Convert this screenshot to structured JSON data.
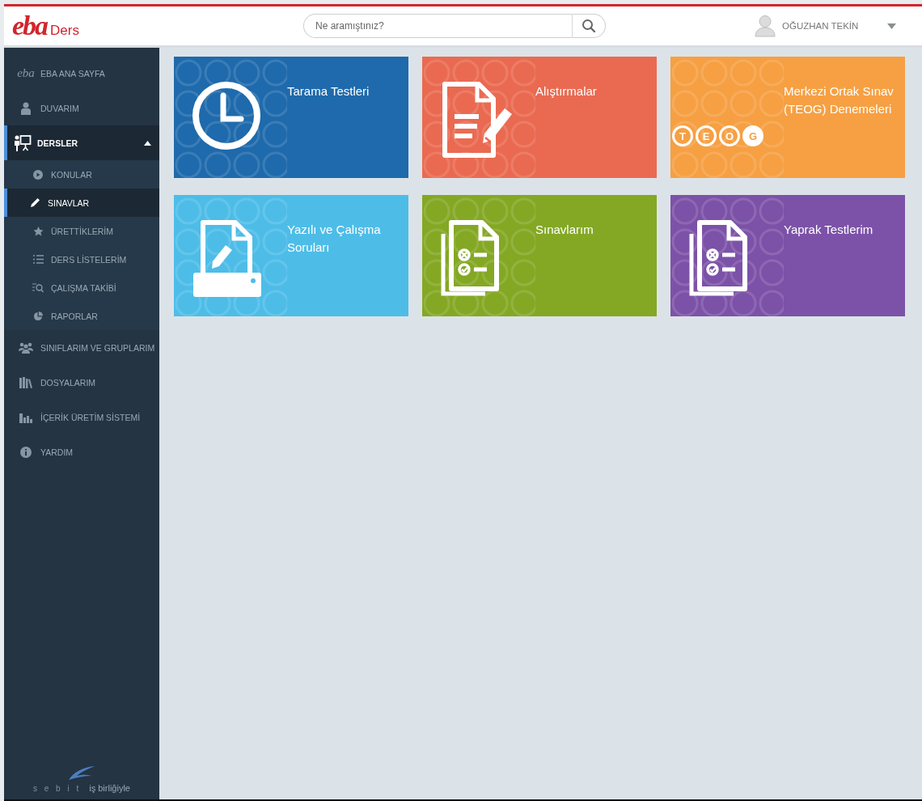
{
  "header": {
    "logo": {
      "mark": "eba",
      "product": "Ders"
    },
    "search": {
      "placeholder": "Ne aramıştınız?"
    },
    "user": {
      "name": "OĞUZHAN TEKİN"
    }
  },
  "sidebar": {
    "items": [
      {
        "mark": "eba",
        "label": "EBA ANA SAYFA",
        "selected": false
      },
      {
        "label": "DUVARIM",
        "selected": false
      },
      {
        "label": "DERSLER",
        "selected": true,
        "expanded": true,
        "children": [
          {
            "label": "KONULAR",
            "selected": false
          },
          {
            "label": "SINAVLAR",
            "selected": true
          },
          {
            "label": "ÜRETTİKLERİM",
            "selected": false
          },
          {
            "label": "DERS LİSTELERİM",
            "selected": false
          },
          {
            "label": "ÇALIŞMA TAKİBİ",
            "selected": false
          },
          {
            "label": "RAPORLAR",
            "selected": false
          }
        ]
      },
      {
        "label": "SINIFLARIM VE GRUPLARIM",
        "selected": false
      },
      {
        "label": "DOSYALARIM",
        "selected": false
      },
      {
        "label": "İÇERİK ÜRETİM SİSTEMİ",
        "selected": false
      },
      {
        "label": "YARDIM",
        "selected": false
      }
    ],
    "footer": {
      "brand": "s e b i t",
      "text": "iş birliğiyle"
    }
  },
  "tiles": [
    {
      "title": "Tarama Testleri",
      "color": "#1e6aac"
    },
    {
      "title": "Alıştırmalar",
      "color": "#ea6a51"
    },
    {
      "title": "Merkezi Ortak Sınav (TEOG) Denemeleri",
      "color": "#f6a043",
      "letters": [
        {
          "text": "T",
          "filled": false
        },
        {
          "text": "E",
          "filled": false
        },
        {
          "text": "O",
          "filled": false
        },
        {
          "text": "G",
          "filled": true
        }
      ]
    },
    {
      "title": "Yazılı ve Çalışma Soruları",
      "color": "#4dbde8"
    },
    {
      "title": "Sınavlarım",
      "color": "#84a824"
    },
    {
      "title": "Yaprak Testlerim",
      "color": "#7c52a8"
    }
  ]
}
